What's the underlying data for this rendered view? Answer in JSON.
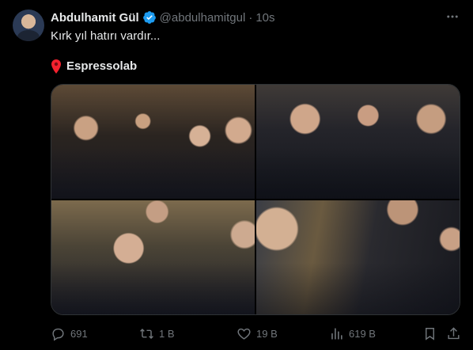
{
  "author": {
    "name": "Abdulhamit Gül",
    "handle": "@abdulhamitgul",
    "separator": "·",
    "time": "10s"
  },
  "tweet": {
    "text": "Kırk yıl hatırı vardır...",
    "location_icon": "pin-icon",
    "location": "Espressolab"
  },
  "media": {
    "photos": [
      "group-photo-cafe",
      "close-up-group",
      "selfie-photo",
      "handshake-photo"
    ]
  },
  "actions": {
    "replies": "691",
    "reposts": "1 B",
    "likes": "19 B",
    "views": "619 B"
  },
  "colors": {
    "background": "#000000",
    "text": "#e7e9ea",
    "muted": "#71767b",
    "verified": "#1d9bf0",
    "pin": "#f4212e"
  }
}
